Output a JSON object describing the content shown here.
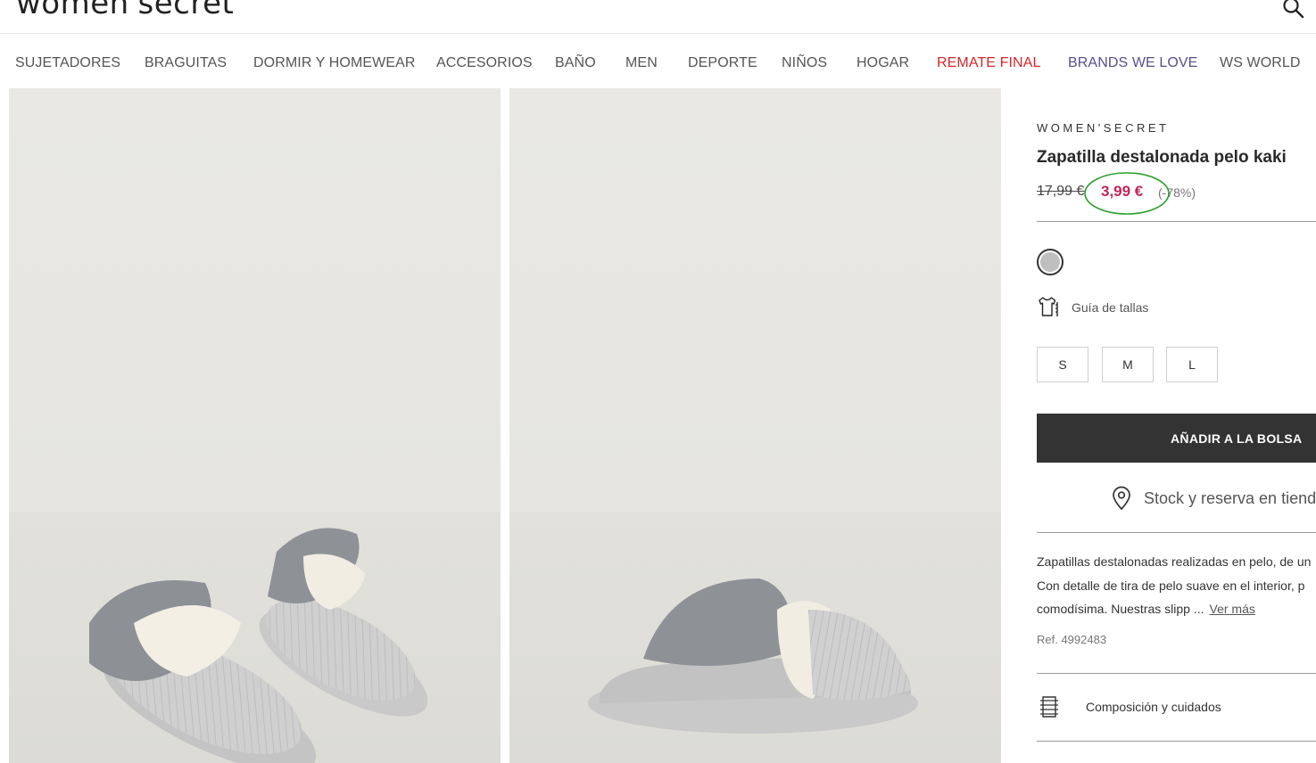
{
  "header": {
    "logo": "women'secret",
    "search_icon": "search-icon"
  },
  "nav": {
    "items": [
      {
        "label": "SUJETADORES"
      },
      {
        "label": "BRAGUITAS"
      },
      {
        "label": "DORMIR Y HOMEWEAR"
      },
      {
        "label": "ACCESORIOS"
      },
      {
        "label": "BAÑO"
      },
      {
        "label": "MEN"
      },
      {
        "label": "DEPORTE"
      },
      {
        "label": "NIÑOS"
      },
      {
        "label": "HOGAR"
      },
      {
        "label": "REMATE FINAL"
      },
      {
        "label": "BRANDS WE LOVE"
      },
      {
        "label": "WS WORLD"
      }
    ]
  },
  "product": {
    "brand": "WOMEN'SECRET",
    "title": "Zapatilla destalonada pelo kaki",
    "old_price": "17,99 €",
    "price": "3,99 €",
    "discount": "(-78%)",
    "size_guide_label": "Guía de tallas",
    "sizes": [
      "S",
      "M",
      "L"
    ],
    "add_to_bag": "AÑADIR A LA BOLSA",
    "stock_label": "Stock y reserva en tienda",
    "description_lines": [
      "Zapatillas destalonadas realizadas en pelo, de un",
      "Con detalle de tira de pelo suave en el interior, p",
      "comodísima. Nuestras slipp ..."
    ],
    "ver_mas": "Ver más",
    "ref": "Ref. 4992483",
    "composition_label": "Composición y cuidados"
  },
  "colors": {
    "price_accent": "#c2255c",
    "sale_nav": "#d4262b",
    "brands_nav": "#5a4d8f",
    "add_button": "#333333",
    "annotation_circle": "#2e9e2e",
    "swatch": "#bfbfbf"
  }
}
